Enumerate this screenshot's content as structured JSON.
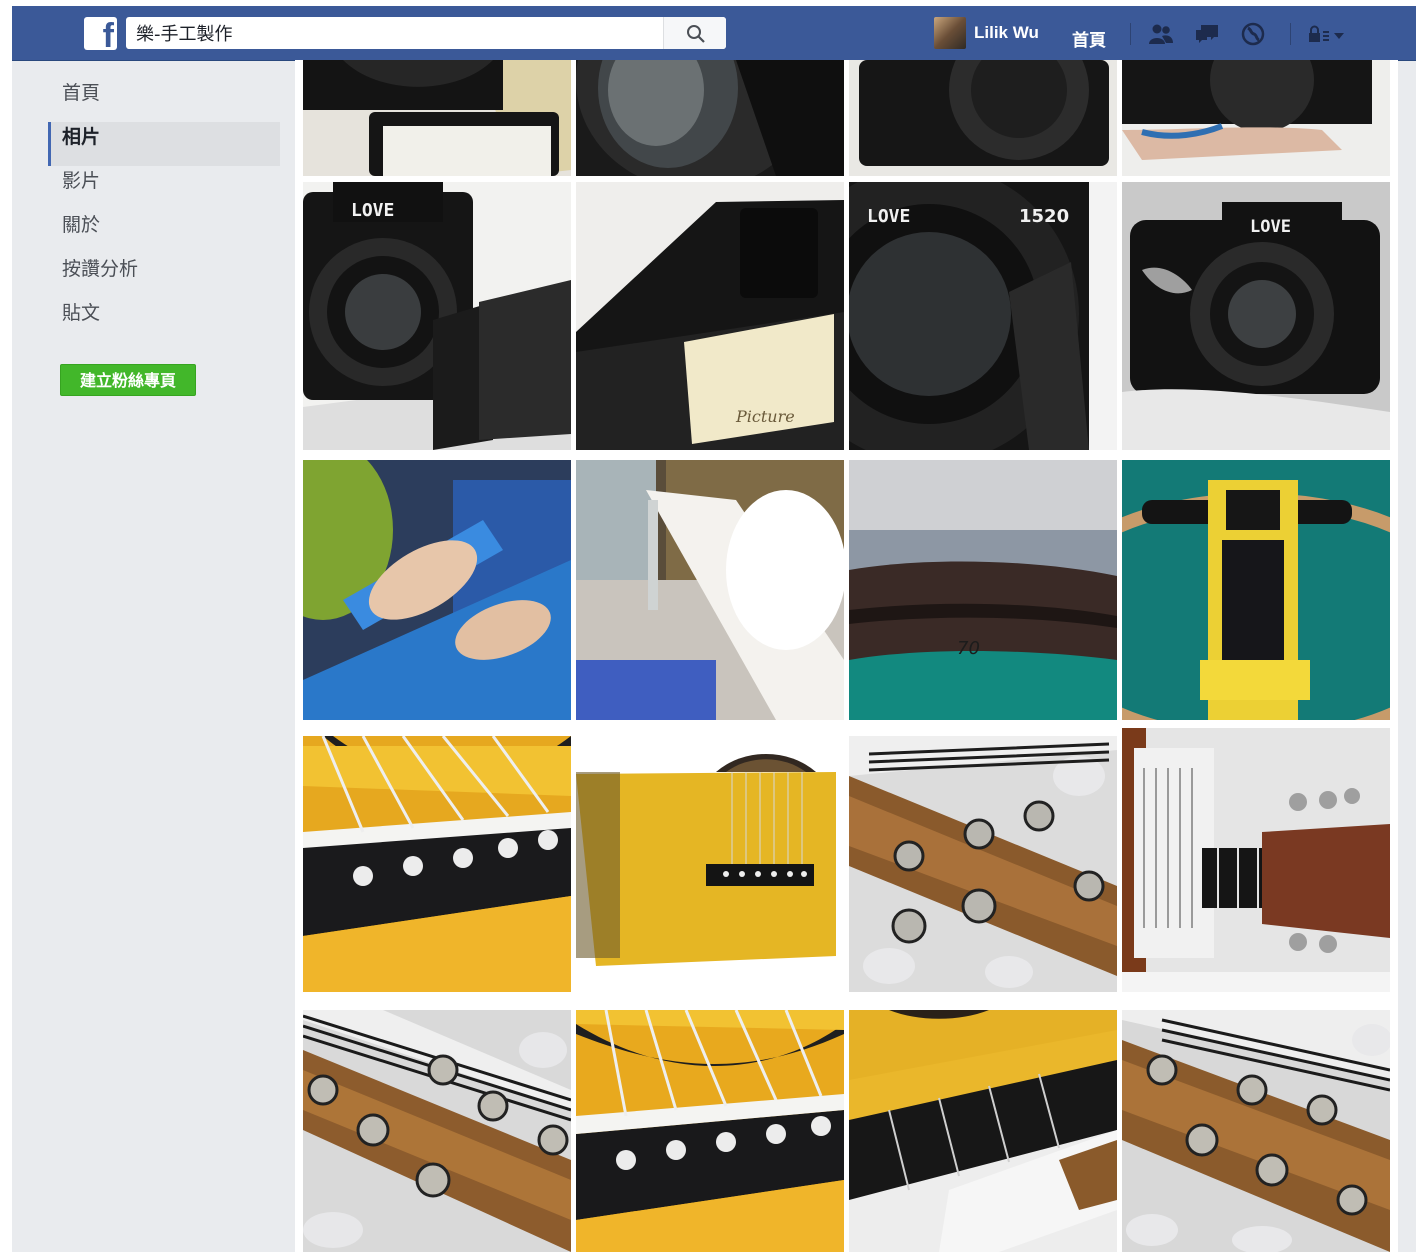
{
  "header": {
    "search_value": "樂-手工製作",
    "user_name": "Lilik Wu",
    "home_label": "首頁"
  },
  "sidebar": {
    "items": [
      {
        "label": "首頁",
        "active": false
      },
      {
        "label": "相片",
        "active": true
      },
      {
        "label": "影片",
        "active": false
      },
      {
        "label": "關於",
        "active": false
      },
      {
        "label": "按讚分析",
        "active": false
      },
      {
        "label": "貼文",
        "active": false
      }
    ],
    "create_page_label": "建立粉絲專頁"
  },
  "photos": {
    "rows": [
      [
        "camera-lens-frame",
        "camera-lens-closeup",
        "camera-lens-front",
        "camera-on-hand"
      ],
      [
        "love-camera-flap",
        "camera-viewfinder-back",
        "love-lens-closeup",
        "love-camera-on-hand"
      ],
      [
        "blue-paper-crafting",
        "glue-applicator",
        "lens-ring-numbers",
        "yellow-pencil-tool"
      ],
      [
        "guitar-bridge-pins",
        "yellow-guitar-body",
        "guitar-headstock-pegs",
        "guitar-fretboard-headstock"
      ],
      [
        "guitar-headstock-tuners",
        "guitar-bridge-strings",
        "guitar-neck-frets",
        "guitar-headstock-logo"
      ]
    ]
  },
  "colors": {
    "topbar": "#3b5998",
    "page_bg": "#e9ebee",
    "create_button": "#42b72a",
    "active_indicator": "#4267b2"
  }
}
